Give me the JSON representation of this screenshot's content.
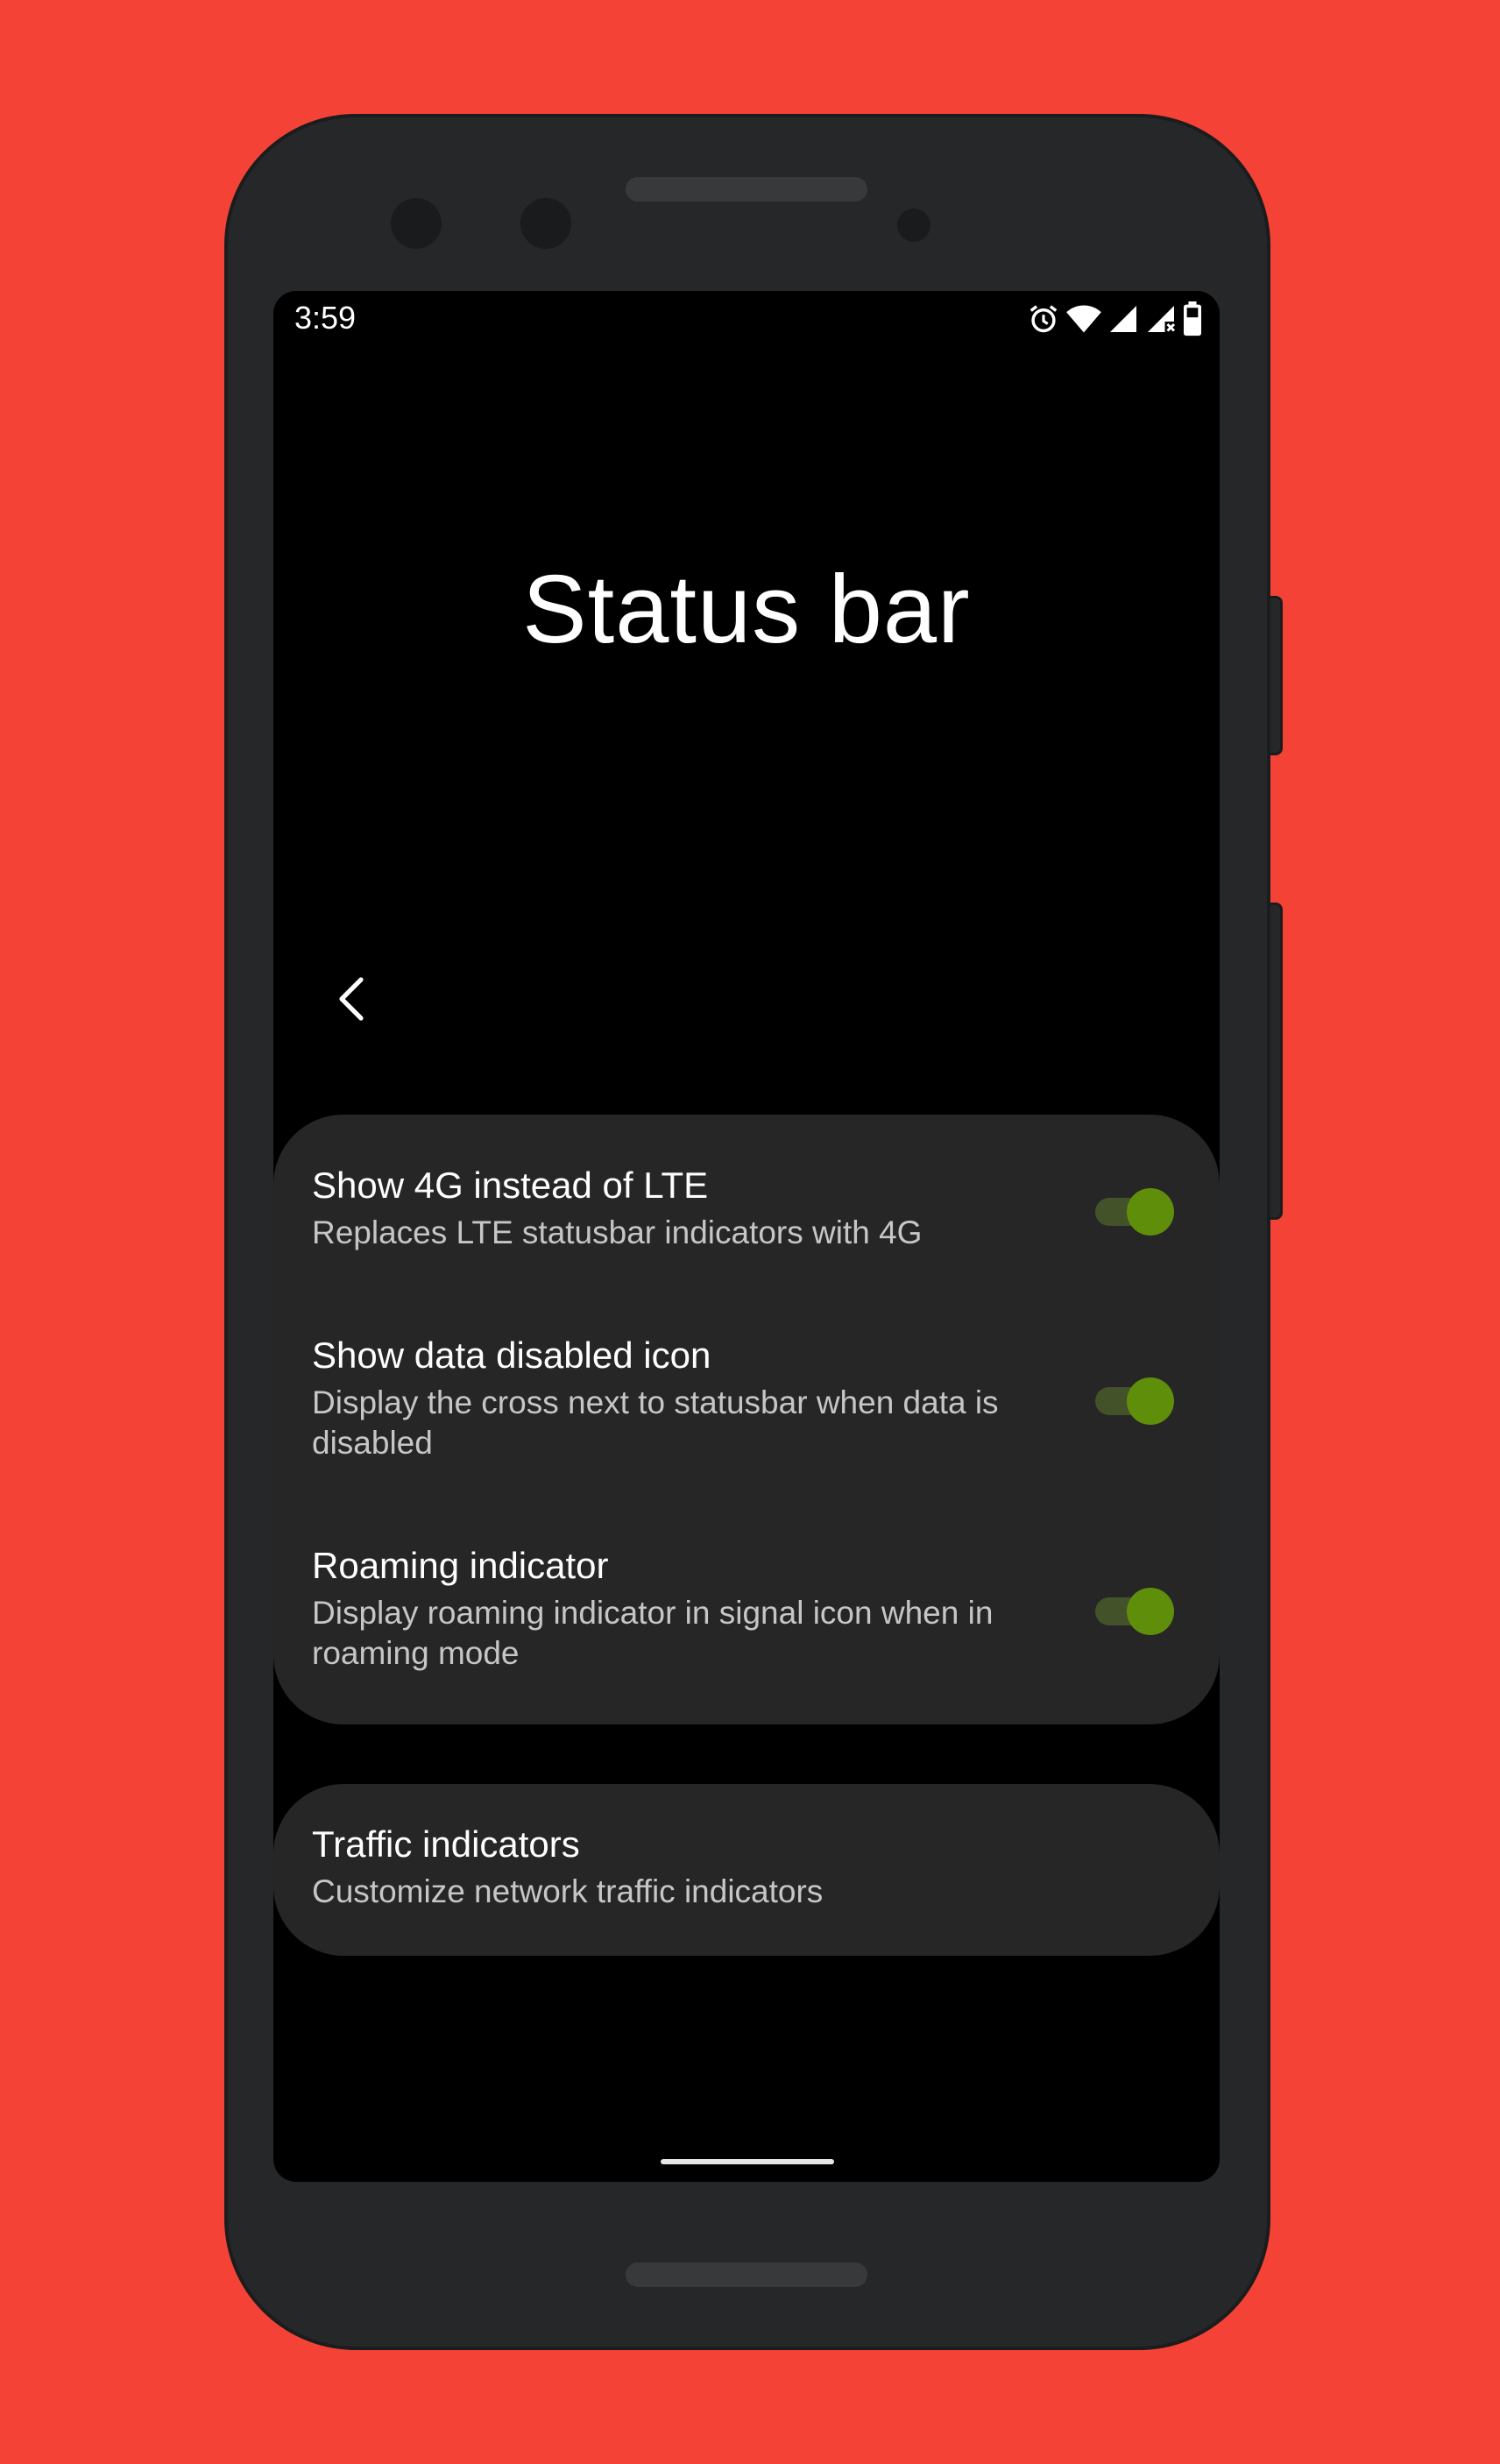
{
  "status_bar": {
    "time": "3:59",
    "icons": [
      "alarm-icon",
      "wifi-icon",
      "signal-icon",
      "signal-disabled-icon",
      "battery-icon"
    ]
  },
  "page": {
    "title": "Status bar"
  },
  "prefs": [
    {
      "title": "Show 4G instead of LTE",
      "summary": "Replaces LTE statusbar indicators with 4G",
      "enabled": true
    },
    {
      "title": "Show data disabled icon",
      "summary": "Display the cross next to statusbar when data is disabled",
      "enabled": true
    },
    {
      "title": "Roaming indicator",
      "summary": "Display roaming indicator in signal icon when in roaming mode",
      "enabled": true
    }
  ],
  "traffic": {
    "title": "Traffic indicators",
    "summary": "Customize network traffic indicators"
  },
  "colors": {
    "background": "#f44336",
    "phone_body": "#262729",
    "card": "#262626",
    "switch_thumb": "#5f8e0a",
    "switch_track": "#44522a"
  }
}
